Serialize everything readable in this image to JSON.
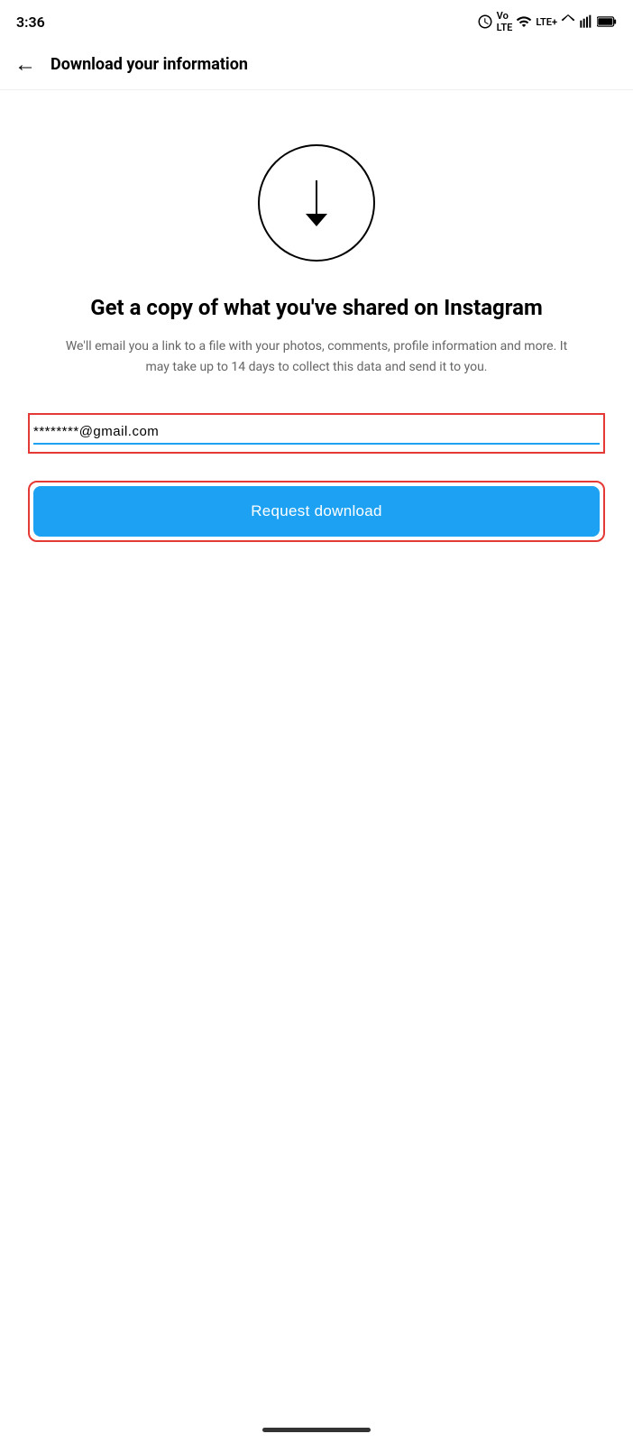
{
  "status_bar": {
    "time": "3:36",
    "icons": [
      "alarm",
      "vo-lte",
      "wifi",
      "lte-plus",
      "signal1",
      "signal2",
      "battery"
    ]
  },
  "header": {
    "back_label": "←",
    "title": "Download your information"
  },
  "main": {
    "heading": "Get a copy of what you've shared on Instagram",
    "description": "We'll email you a link to a file with your photos, comments, profile information and more. It may take up to 14 days to collect this data and send it to you.",
    "email_placeholder": "********@gmail.com",
    "email_value": "********@gmail.com",
    "request_button_label": "Request download"
  },
  "colors": {
    "accent_blue": "#1da1f2",
    "highlight_red": "#e53935",
    "text_primary": "#000000",
    "text_secondary": "#666666",
    "bg_white": "#ffffff"
  }
}
